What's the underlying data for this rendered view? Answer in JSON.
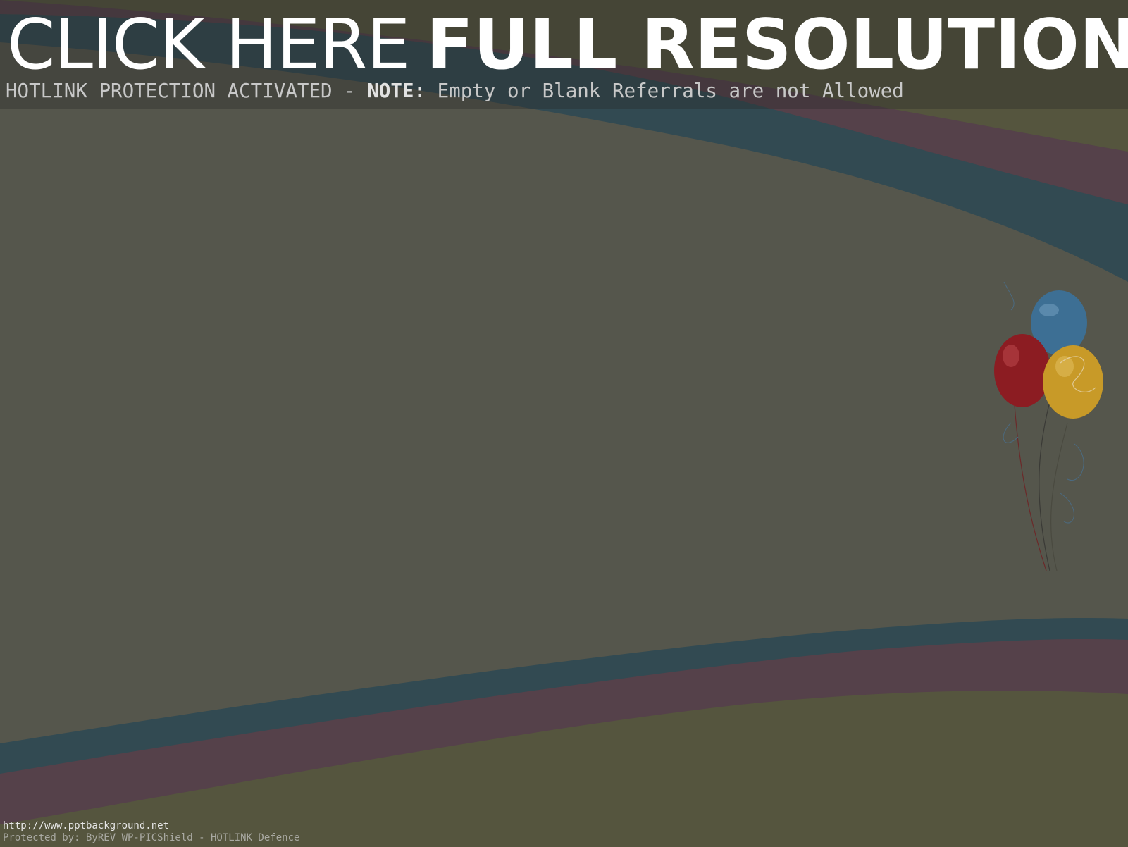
{
  "banner": {
    "headline_light": "CLICK HERE",
    "headline_bold": "FULL RESOLUTION",
    "notice": "HOTLINK PROTECTION ACTIVATED - ",
    "notice_strong": "NOTE:",
    "notice_tail": " Empty or Blank Referrals are not Allowed"
  },
  "footer": {
    "url": "http://www.pptbackground.net",
    "protected_by": "Protected by: ByREV WP-PICShield - HOTLINK Defence"
  },
  "colors": {
    "background": "#55564c",
    "wave_teal": "#324a52",
    "wave_maroon": "#55414a",
    "wave_olive": "#55553e",
    "balloon_blue": "#3d6f94",
    "balloon_red": "#8c1c22",
    "balloon_yellow": "#c89a28"
  },
  "icons": [
    "balloons-illustration"
  ]
}
